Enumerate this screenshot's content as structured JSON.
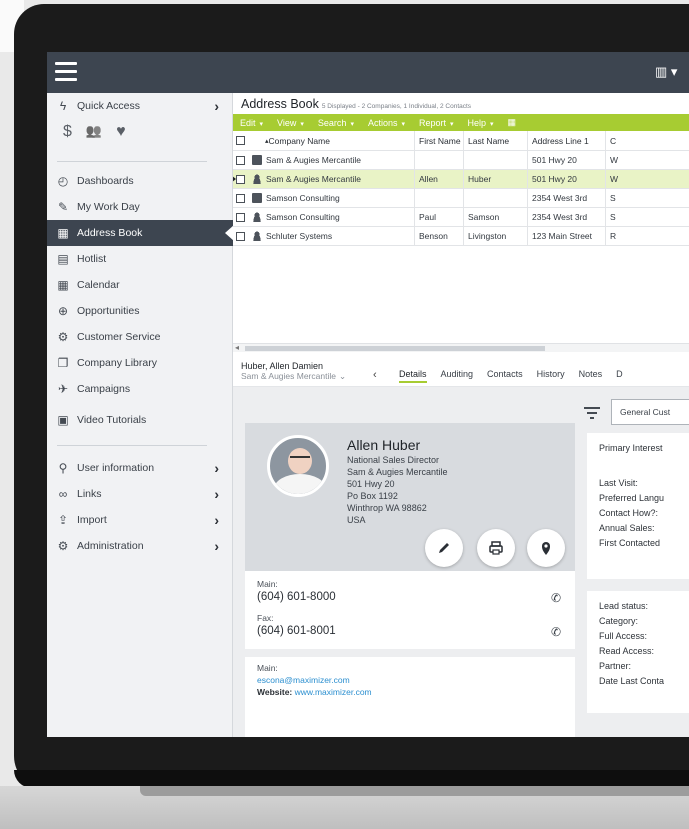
{
  "topbar": {
    "menu_icon": "hamburger-icon",
    "right_icon": "book-icon",
    "right_caret": "▾"
  },
  "sidebar": {
    "quick_access": {
      "label": "Quick Access",
      "icon": "lightning-icon",
      "chevron": "›"
    },
    "quick_icons": [
      {
        "icon": "dollar-icon",
        "glyph": "$"
      },
      {
        "icon": "people-icon",
        "glyph": "👥"
      },
      {
        "icon": "heart-icon",
        "glyph": "♥"
      }
    ],
    "items": [
      {
        "label": "Dashboards",
        "icon": "dashboard-icon",
        "glyph": "◴"
      },
      {
        "label": "My Work Day",
        "icon": "edit-icon",
        "glyph": "✎"
      },
      {
        "label": "Address Book",
        "icon": "book-icon",
        "glyph": "▦"
      },
      {
        "label": "Hotlist",
        "icon": "hotlist-icon",
        "glyph": "▤"
      },
      {
        "label": "Calendar",
        "icon": "calendar-icon",
        "glyph": "▦"
      },
      {
        "label": "Opportunities",
        "icon": "opportunities-icon",
        "glyph": "⊕"
      },
      {
        "label": "Customer Service",
        "icon": "service-icon",
        "glyph": "⚙"
      },
      {
        "label": "Company Library",
        "icon": "library-icon",
        "glyph": "❐"
      },
      {
        "label": "Campaigns",
        "icon": "megaphone-icon",
        "glyph": "✈"
      }
    ],
    "video": {
      "label": "Video Tutorials",
      "icon": "video-icon",
      "glyph": "▣"
    },
    "bottom": [
      {
        "label": "User information",
        "icon": "user-icon",
        "glyph": "⚲",
        "chevron": "›"
      },
      {
        "label": "Links",
        "icon": "link-icon",
        "glyph": "∞",
        "chevron": "›"
      },
      {
        "label": "Import",
        "icon": "import-icon",
        "glyph": "⇪",
        "chevron": "›"
      },
      {
        "label": "Administration",
        "icon": "admin-icon",
        "glyph": "⚙",
        "chevron": "›"
      }
    ]
  },
  "address_book": {
    "title": "Address Book",
    "summary": "5 Displayed - 2 Companies, 1 Individual, 2 Contacts",
    "toolbar": [
      "Edit",
      "View",
      "Search",
      "Actions",
      "Report",
      "Help"
    ],
    "columns": [
      "Company Name",
      "First Name",
      "Last Name",
      "Address Line 1",
      "C"
    ],
    "rows": [
      {
        "type": "company",
        "company": "Sam & Augies Mercantile",
        "first": "",
        "last": "",
        "address": "501 Hwy 20",
        "extra": "W"
      },
      {
        "type": "person",
        "company": "Sam & Augies Mercantile",
        "first": "Allen",
        "last": "Huber",
        "address": "501 Hwy 20",
        "extra": "W"
      },
      {
        "type": "company",
        "company": "Samson Consulting",
        "first": "",
        "last": "",
        "address": "2354 West 3rd",
        "extra": "S"
      },
      {
        "type": "person",
        "company": "Samson Consulting",
        "first": "Paul",
        "last": "Samson",
        "address": "2354 West 3rd",
        "extra": "S"
      },
      {
        "type": "individual",
        "company": "Schluter Systems",
        "first": "Benson",
        "last": "Livingston",
        "address": "123 Main Street",
        "extra": "R"
      }
    ]
  },
  "detail": {
    "name": "Huber, Allen Damien",
    "company": "Sam & Augies Mercantile",
    "tabs": [
      "Details",
      "Auditing",
      "Contacts",
      "History",
      "Notes",
      "D"
    ]
  },
  "contact_card": {
    "name": "Allen Huber",
    "lines": [
      "National Sales Director",
      "Sam & Augies Mercantile",
      "501 Hwy 20",
      "Po Box 1192",
      "Winthrop WA 98862",
      "USA"
    ],
    "main_label": "Main:",
    "main_phone": "(604) 601-8000",
    "fax_label": "Fax:",
    "fax_phone": "(604) 601-8001",
    "email_label": "Main:",
    "email": "escona@maximizer.com",
    "website_label": "Website:",
    "website": "www.maximizer.com"
  },
  "right_panel": {
    "dropdown": "General Cust",
    "group1": [
      "Primary Interest",
      "Last Visit:",
      "Preferred Langu",
      "Contact How?:",
      "Annual Sales:",
      "First Contacted"
    ],
    "group2": [
      "Lead status:",
      "Category:",
      "Full Access:",
      "Read Access:",
      "Partner:",
      "Date Last Conta"
    ]
  },
  "colors": {
    "accent": "#a7cc32",
    "dark": "#3d4550",
    "link": "#2b8fd0"
  }
}
